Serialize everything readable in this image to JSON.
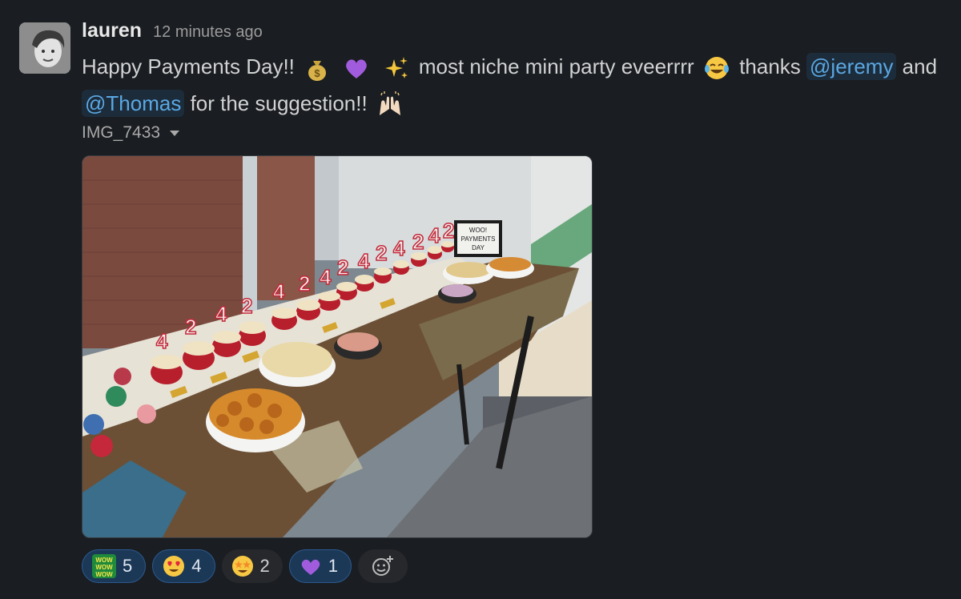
{
  "message": {
    "author": "lauren",
    "time": "12 minutes ago",
    "text_a": "Happy Payments Day!!",
    "text_b": "most niche mini party eveerrrr",
    "text_c": "thanks",
    "mention_1": "@jeremy",
    "text_d": "and",
    "mention_2": "@Thomas",
    "text_e": "for the suggestion!!"
  },
  "attachment": {
    "filename": "IMG_7433",
    "lightbox_text": [
      "WOO!",
      "PAYMENTS",
      "DAY"
    ]
  },
  "reactions": [
    {
      "icon": "wow-icon",
      "count": "5",
      "selected": true
    },
    {
      "icon": "heart-eyes-icon",
      "count": "4",
      "selected": true
    },
    {
      "icon": "starstruck-icon",
      "count": "2",
      "selected": false
    },
    {
      "icon": "purple-heart-icon",
      "count": "1",
      "selected": true
    }
  ],
  "reaction_label_wow": [
    "WOW",
    "WOW",
    "WOW"
  ],
  "colors": {
    "background": "#1a1d21",
    "mention_text": "#5aa8e3",
    "mention_bg": "#1d2c3b",
    "reaction_selected": "#1c3857"
  }
}
